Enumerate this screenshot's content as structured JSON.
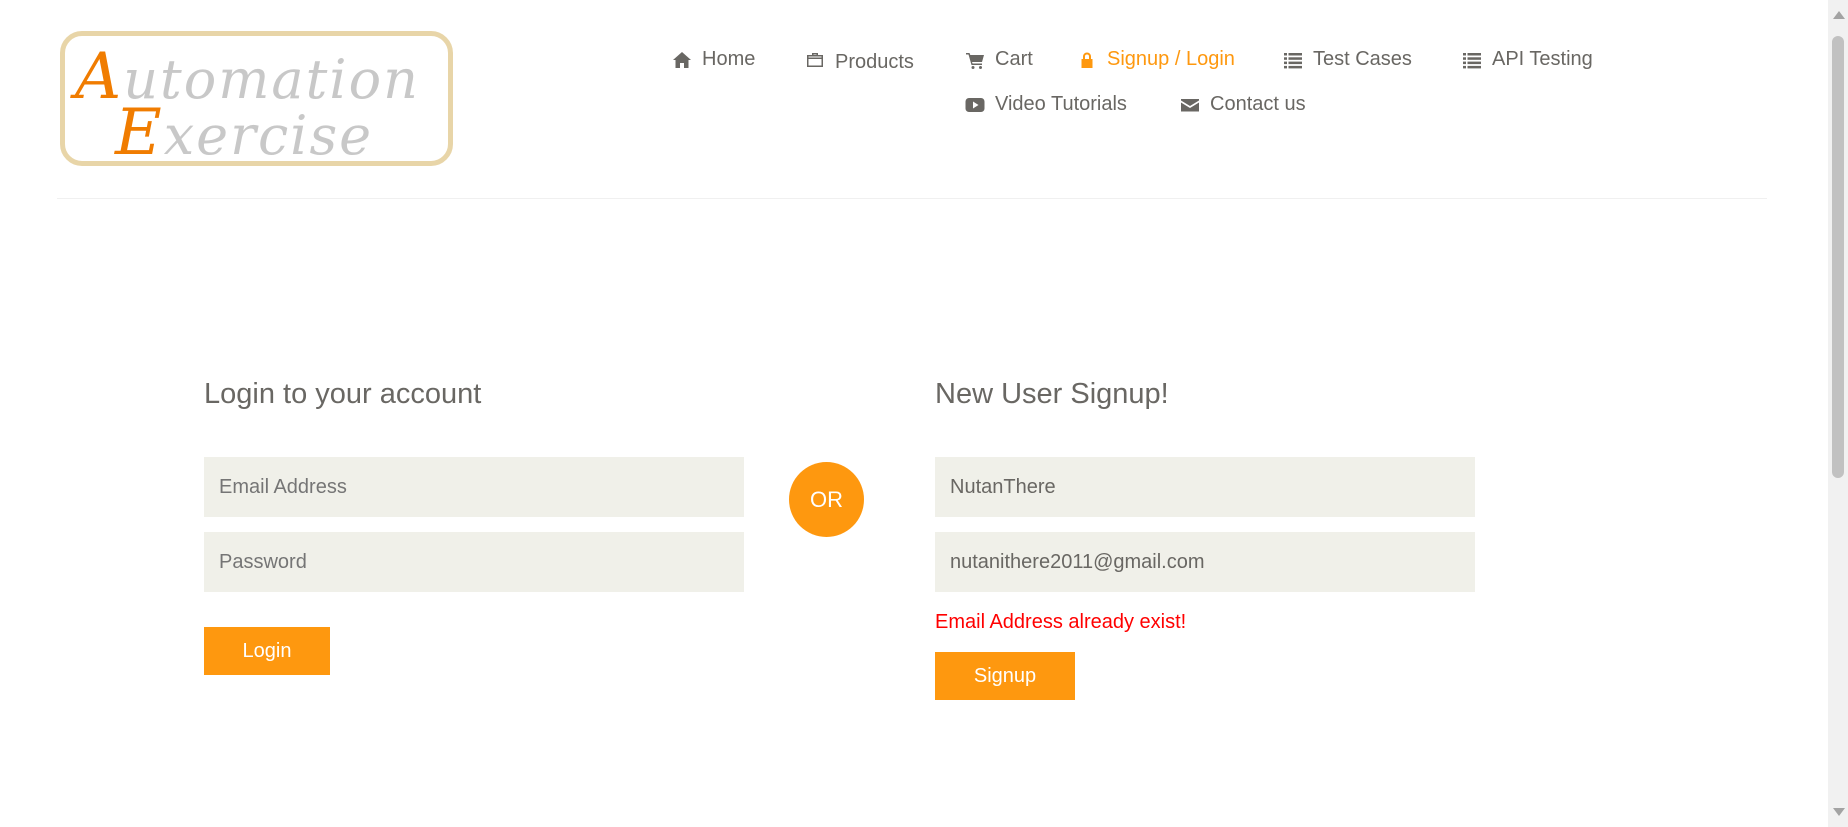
{
  "logo": {
    "line1_first": "A",
    "line1_rest": "utomation",
    "line2_first": "E",
    "line2_rest": "xercise"
  },
  "nav": {
    "home": "Home",
    "products": "Products",
    "cart": "Cart",
    "signup_login": "Signup / Login",
    "test_cases": "Test Cases",
    "api_testing": "API Testing",
    "video_tutorials": "Video Tutorials",
    "contact_us": "Contact us"
  },
  "login": {
    "title": "Login to your account",
    "email_placeholder": "Email Address",
    "password_placeholder": "Password",
    "button": "Login"
  },
  "or_label": "OR",
  "signup": {
    "title": "New User Signup!",
    "name_value": "NutanThere",
    "email_value": "nutanithere2011@gmail.com",
    "error": "Email Address already exist!",
    "button": "Signup"
  },
  "colors": {
    "accent": "#fe980f",
    "error": "#ff0000",
    "field_bg": "#f0f0e9",
    "text": "#696763"
  },
  "icons": [
    "home-icon",
    "briefcase-icon",
    "cart-icon",
    "lock-icon",
    "list-icon",
    "youtube-icon",
    "envelope-icon"
  ]
}
